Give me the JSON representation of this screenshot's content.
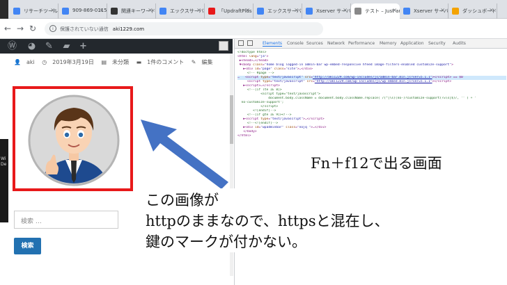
{
  "browser": {
    "tabs": [
      {
        "label": "リサーチツールを…",
        "color": "#4285f4"
      },
      {
        "label": "909-869-0115",
        "color": "#4285f4"
      },
      {
        "label": "関連キーワード取…",
        "color": "#333333"
      },
      {
        "label": "エックスサーバー…",
        "color": "#4285f4"
      },
      {
        "label": "「UpdraftPlus",
        "color": "#e8191a"
      },
      {
        "label": "エックスサーバー…",
        "color": "#4285f4"
      },
      {
        "label": "Xserver サーバー",
        "color": "#4285f4"
      },
      {
        "label": "テスト – Just an…",
        "color": "#888888"
      },
      {
        "label": "Xserver サーバー",
        "color": "#4285f4"
      },
      {
        "label": "ダッシュボード‹",
        "color": "#f4a300"
      }
    ],
    "address": {
      "security_label": "保護されていない通信",
      "host": "aki1229.com"
    }
  },
  "post_meta": {
    "author": "aki",
    "date": "2019年3月19日",
    "category": "未分類",
    "comments": "1件のコメント",
    "edit": "編集"
  },
  "sidebar": {
    "search_placeholder": "検索 …",
    "search_button": "検索"
  },
  "devtools": {
    "tabs": [
      "Elements",
      "Console",
      "Sources",
      "Network",
      "Performance",
      "Memory",
      "Application",
      "Security",
      "Audits"
    ],
    "active_tab": "Elements"
  },
  "annotation": {
    "caption": "Fn＋f12で出る画面",
    "lines": [
      "この画像が",
      "httpのままなので、httpsと混在し、",
      "鍵のマークが付かない。"
    ]
  },
  "desktop_edge": "Wi\nDe"
}
